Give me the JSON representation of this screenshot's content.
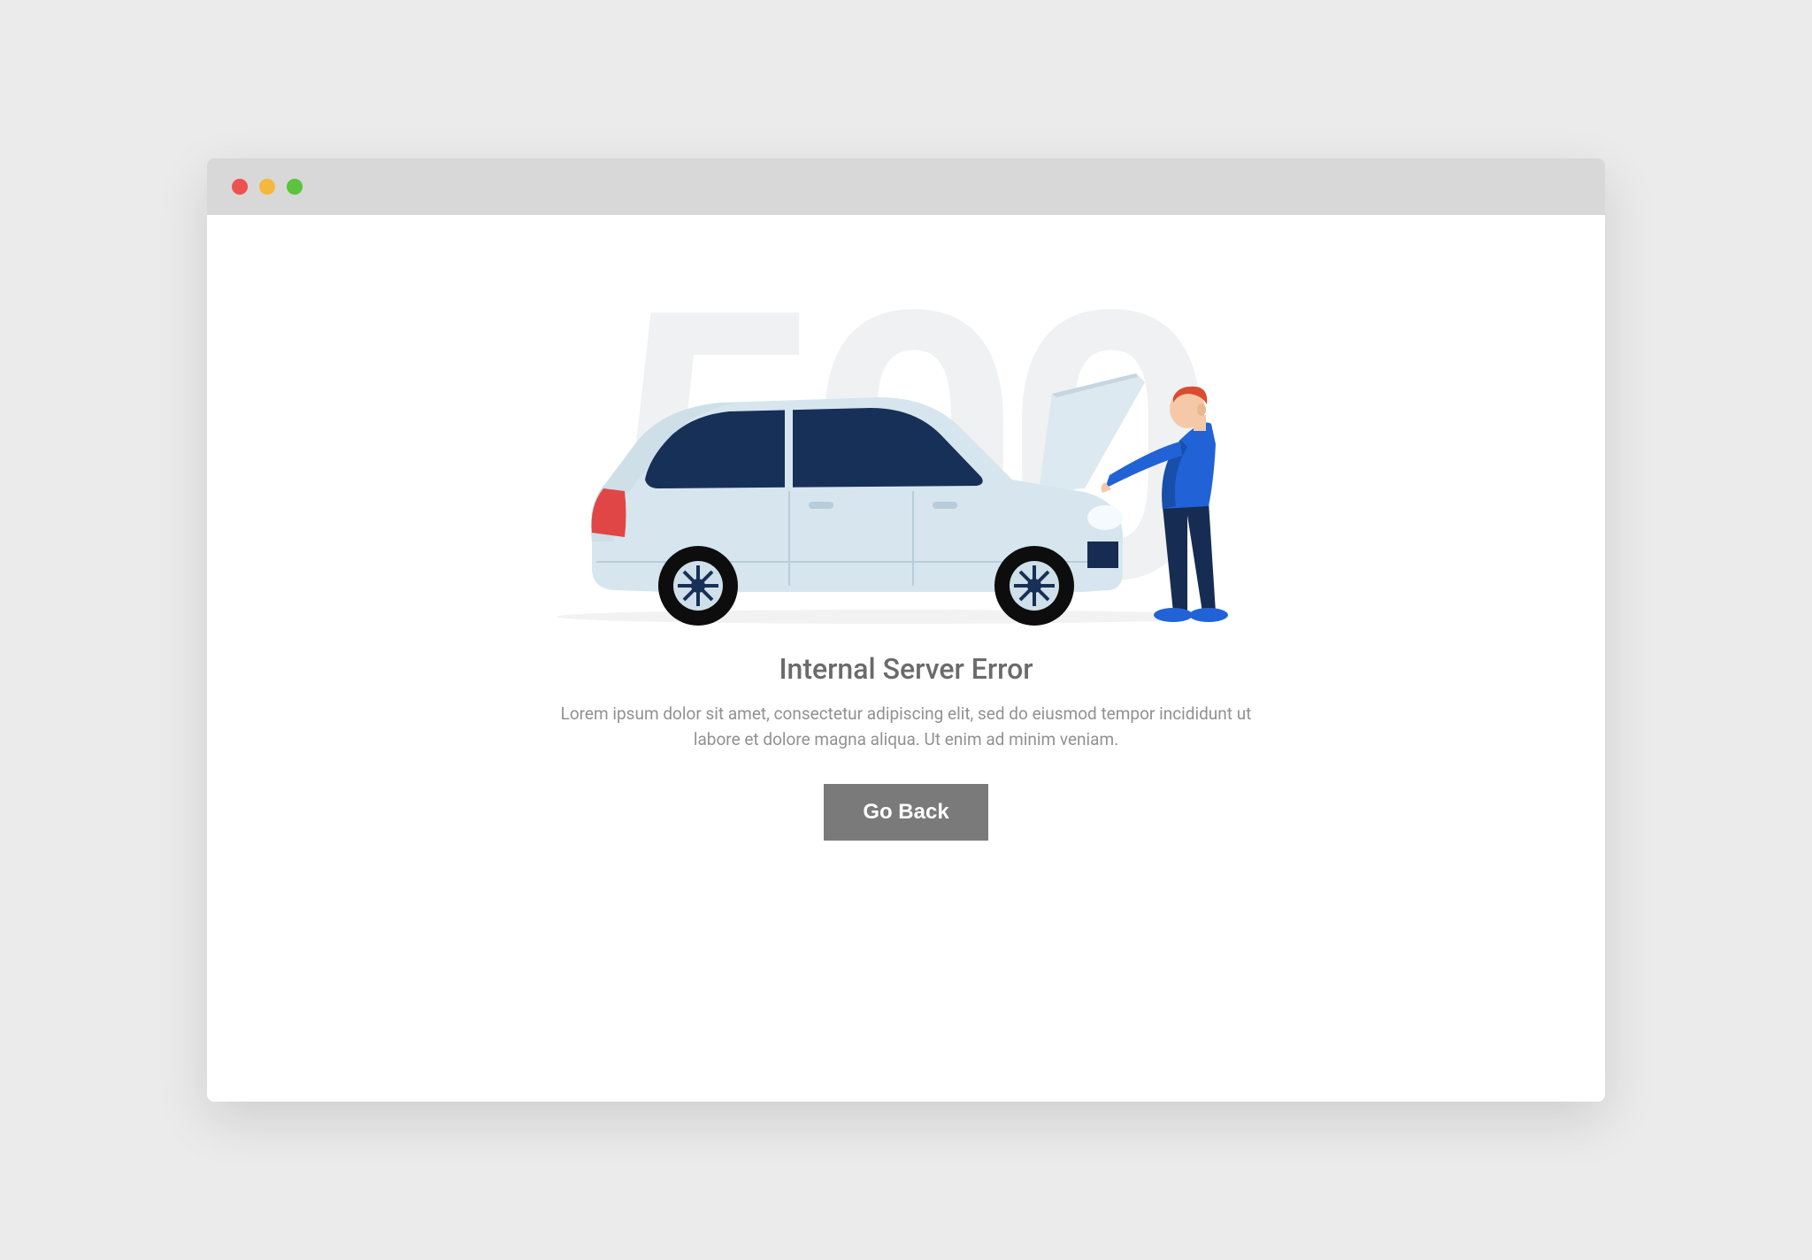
{
  "error": {
    "code": "500",
    "title": "Internal Server Error",
    "description": "Lorem ipsum dolor sit amet, consectetur adipiscing elit, sed do eiusmod tempor incididunt ut labore et dolore magna aliqua. Ut enim ad minim veniam.",
    "button_label": "Go Back"
  },
  "illustration": {
    "name": "car-breakdown-mechanic",
    "car_body_color": "#d7e6ee",
    "car_window_color": "#173058",
    "wheel_color": "#0d0d0d",
    "wheel_rim_color": "#cfe0ea",
    "person_shirt_color": "#2163d6",
    "person_pants_color": "#162c53",
    "person_hair_color": "#da4b32",
    "taillight_color": "#e04646"
  },
  "window_controls": {
    "close_color": "#ed5250",
    "minimize_color": "#f3b83c",
    "maximize_color": "#5bc33d"
  }
}
